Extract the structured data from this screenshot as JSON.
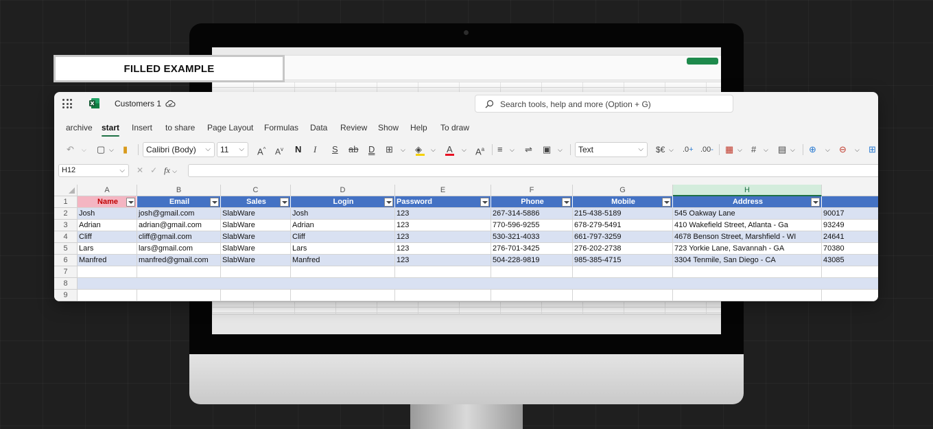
{
  "label": "FILLED EXAMPLE",
  "app": {
    "doc_title": "Customers 1",
    "search_placeholder": "Search tools, help and more (Option + G)",
    "tabs": [
      {
        "label": "archive"
      },
      {
        "label": "start",
        "active": true
      },
      {
        "label": "Insert"
      },
      {
        "label": "to share"
      },
      {
        "label": "Page Layout"
      },
      {
        "label": "Formulas"
      },
      {
        "label": "Data"
      },
      {
        "label": "Review"
      },
      {
        "label": "Show"
      },
      {
        "label": "Help"
      },
      {
        "label": "To draw"
      }
    ],
    "toolbar": {
      "font_family": "Calibri (Body)",
      "font_size": "11",
      "number_format": "Text",
      "bold_glyph": "N",
      "italic_glyph": "I",
      "underline_glyph": "S",
      "strike_glyph": "ab",
      "double_underline_glyph": "D",
      "currency_glyph": "$€"
    },
    "formula_bar": {
      "name_box": "H12",
      "fx_label": "fx"
    },
    "colors": {
      "accent": "#1e7145",
      "header_fill": "#4472c4",
      "band_fill": "#d9e1f2",
      "name_header_fill": "#f4b5c2",
      "name_header_text": "#c00000"
    }
  },
  "sheet": {
    "columns": [
      "A",
      "B",
      "C",
      "D",
      "E",
      "F",
      "G",
      "H"
    ],
    "selected_column": "H",
    "header_row": [
      "Name",
      "Email",
      "Sales",
      "Login",
      "Password",
      "Phone",
      "Mobile",
      "Address"
    ],
    "rows": [
      [
        "Josh",
        "josh@gmail.com",
        "SlabWare",
        "Josh",
        "123",
        "267-314-5886",
        "215-438-5189",
        "545 Oakway Lane",
        "90017"
      ],
      [
        "Adrian",
        "adrian@gmail.com",
        "SlabWare",
        "Adrian",
        "123",
        "770-596-9255",
        "678-279-5491",
        "410 Wakefield Street, Atlanta  - Ga",
        "93249"
      ],
      [
        "Cliff",
        "cliff@gmail.com",
        "SlabWare",
        "Cliff",
        "123",
        "530-321-4033",
        "661-797-3259",
        "4678 Benson Street, Marshfield - WI",
        "24641"
      ],
      [
        "Lars",
        "lars@gmail.com",
        "SlabWare",
        "Lars",
        "123",
        "276-701-3425",
        "276-202-2738",
        "723 Yorkie Lane, Savannah - GA",
        "70380"
      ],
      [
        "Manfred",
        "manfred@gmail.com",
        "SlabWare",
        "Manfred",
        "123",
        "504-228-9819",
        "985-385-4715",
        "3304 Tenmile, San Diego - CA",
        "43085"
      ]
    ],
    "row_numbers": [
      "1",
      "2",
      "3",
      "4",
      "5",
      "6",
      "7",
      "8",
      "9"
    ]
  }
}
